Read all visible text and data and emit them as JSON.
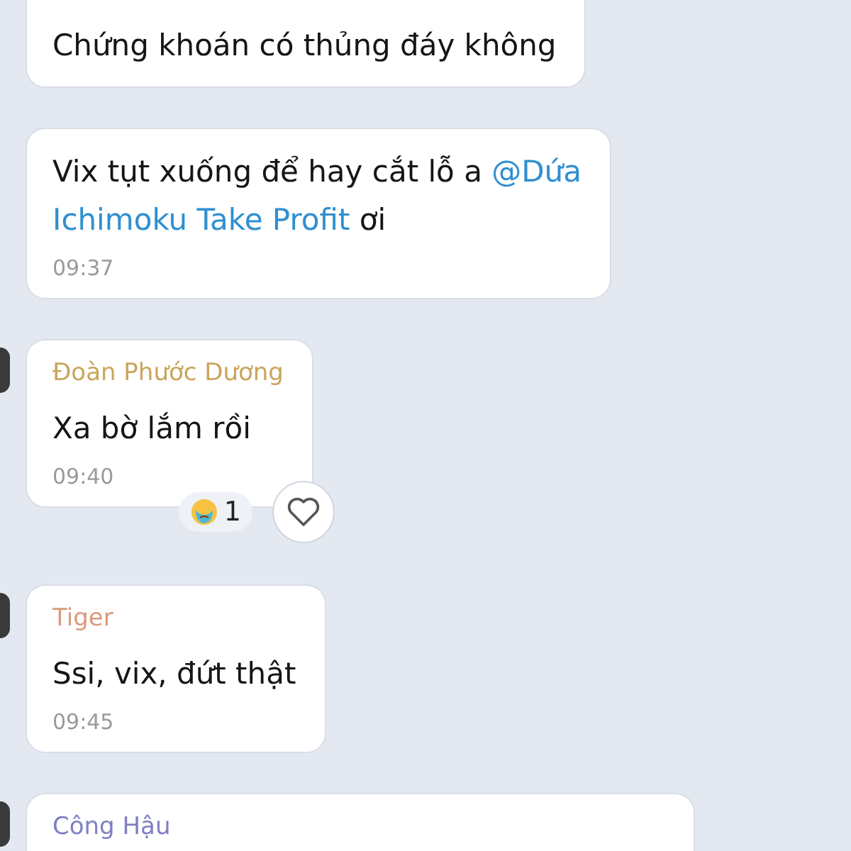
{
  "messages": [
    {
      "avatar": false,
      "lines": [
        {
          "parts": [
            {
              "kind": "text",
              "text": "Chứng khoán có thủng đáy không"
            }
          ]
        }
      ],
      "cut_top": true
    },
    {
      "avatar": false,
      "lines": [
        {
          "parts": [
            {
              "kind": "text",
              "text": "Vix tụt xuống để hay cắt lỗ a "
            },
            {
              "kind": "mention",
              "text": "@Dứa"
            }
          ]
        },
        {
          "parts": [
            {
              "kind": "mention",
              "text": "Ichimoku Take Profit"
            },
            {
              "kind": "text",
              "text": " ơi"
            }
          ]
        }
      ],
      "time": "09:37",
      "cut_top": false
    },
    {
      "sender": {
        "name": "Đoàn Phước Dương",
        "color": "#c9a55a"
      },
      "avatar": true,
      "lines": [
        {
          "parts": [
            {
              "kind": "text",
              "text": "Xa bờ lắm rồi"
            }
          ]
        }
      ],
      "time": "09:40",
      "cut_top": false,
      "reaction": {
        "count": "1"
      },
      "like_button": true
    },
    {
      "sender": {
        "name": "Tiger",
        "color": "#d99a7a"
      },
      "avatar": true,
      "lines": [
        {
          "parts": [
            {
              "kind": "text",
              "text": "Ssi, vix, đứt thật"
            }
          ]
        }
      ],
      "time": "09:45",
      "cut_top": false
    },
    {
      "sender": {
        "name": "Công Hậu",
        "color": "#7f7fc4"
      },
      "avatar": true,
      "cut_top": false,
      "cut_bottom": true
    }
  ]
}
